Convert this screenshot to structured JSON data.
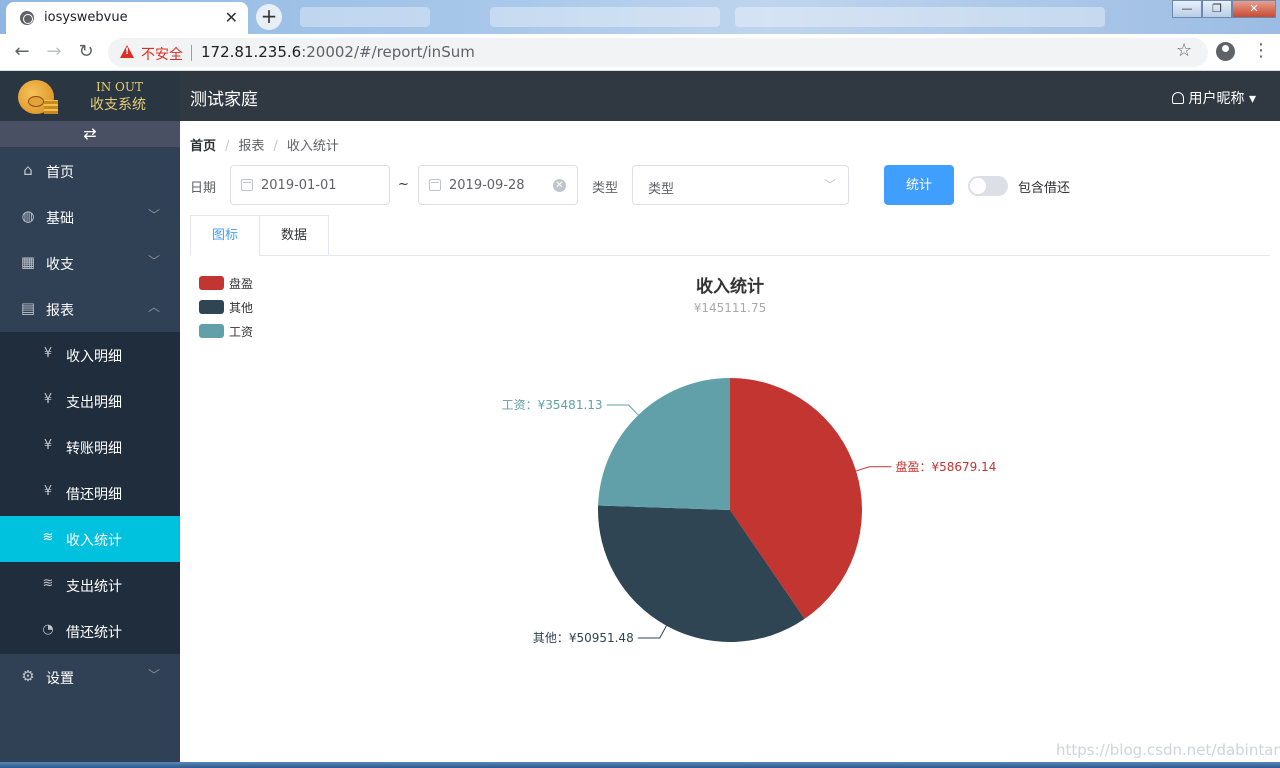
{
  "browser": {
    "tab_title": "iosyswebvue",
    "insecure_label": "不安全",
    "url_host": "172.81.235.6",
    "url_rest": ":20002/#/report/inSum"
  },
  "sidebar": {
    "logo_text_1": "IN OUT",
    "logo_text_2": "收支系统",
    "collapse_icon": "⇄",
    "items": [
      {
        "label": "首页",
        "icon": "home-icon"
      },
      {
        "label": "基础",
        "icon": "planet-icon"
      },
      {
        "label": "收支",
        "icon": "calculator-icon"
      },
      {
        "label": "报表",
        "icon": "report-icon"
      },
      {
        "label": "设置",
        "icon": "gear-icon"
      }
    ],
    "report_subitems": [
      {
        "label": "收入明细",
        "icon": "income-detail-icon"
      },
      {
        "label": "支出明细",
        "icon": "expense-detail-icon"
      },
      {
        "label": "转账明细",
        "icon": "transfer-detail-icon"
      },
      {
        "label": "借还明细",
        "icon": "loan-detail-icon"
      },
      {
        "label": "收入统计",
        "icon": "income-stat-icon",
        "active": true
      },
      {
        "label": "支出统计",
        "icon": "expense-stat-icon"
      },
      {
        "label": "借还统计",
        "icon": "loan-stat-icon"
      }
    ]
  },
  "header": {
    "family_name": "测试家庭",
    "user_label": "用户昵称"
  },
  "breadcrumb": [
    "首页",
    "报表",
    "收入统计"
  ],
  "filters": {
    "date_label": "日期",
    "start_date": "2019-01-01",
    "end_date": "2019-09-28",
    "range_sep": "~",
    "type_label": "类型",
    "type_placeholder": "类型",
    "submit_label": "统计",
    "include_loan_label": "包含借还",
    "include_loan": false
  },
  "tabs": [
    {
      "label": "图标",
      "active": true
    },
    {
      "label": "数据",
      "active": false
    }
  ],
  "colors": {
    "accent": "#409eff",
    "sidebar_active": "#00c1de",
    "sidebar_bg": "#304156",
    "header_bg": "#303841"
  },
  "chart_data": {
    "type": "pie",
    "title": "收入统计",
    "subtitle": "¥145111.75",
    "legend_position": "top-left",
    "slices": [
      {
        "name": "盘盈",
        "value": 58679.14,
        "label": "盘盈：¥58679.14",
        "color": "#c23531"
      },
      {
        "name": "其他",
        "value": 50951.48,
        "label": "其他：¥50951.48",
        "color": "#2f4554"
      },
      {
        "name": "工资",
        "value": 35481.13,
        "label": "工资：¥35481.13",
        "color": "#61a0a8"
      }
    ]
  }
}
